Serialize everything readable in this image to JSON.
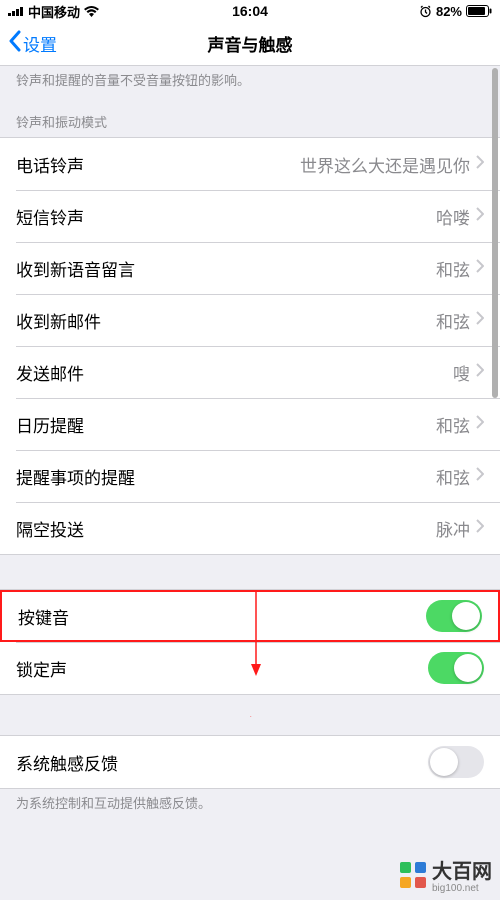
{
  "status": {
    "carrier": "中国移动",
    "time": "16:04",
    "battery": "82%"
  },
  "nav": {
    "back": "设置",
    "title": "声音与触感"
  },
  "top_note": "铃声和提醒的音量不受音量按钮的影响。",
  "section_header": "铃声和振动模式",
  "rows": [
    {
      "label": "电话铃声",
      "value": "世界这么大还是遇见你"
    },
    {
      "label": "短信铃声",
      "value": "哈喽"
    },
    {
      "label": "收到新语音留言",
      "value": "和弦"
    },
    {
      "label": "收到新邮件",
      "value": "和弦"
    },
    {
      "label": "发送邮件",
      "value": "嗖"
    },
    {
      "label": "日历提醒",
      "value": "和弦"
    },
    {
      "label": "提醒事项的提醒",
      "value": "和弦"
    },
    {
      "label": "隔空投送",
      "value": "脉冲"
    }
  ],
  "toggle1": {
    "label": "按键音"
  },
  "toggle2": {
    "label": "锁定声"
  },
  "toggle3": {
    "label": "系统触感反馈"
  },
  "bottom_note": "为系统控制和互动提供触感反馈。",
  "watermark": {
    "name": "大百网",
    "url": "big100.net"
  }
}
